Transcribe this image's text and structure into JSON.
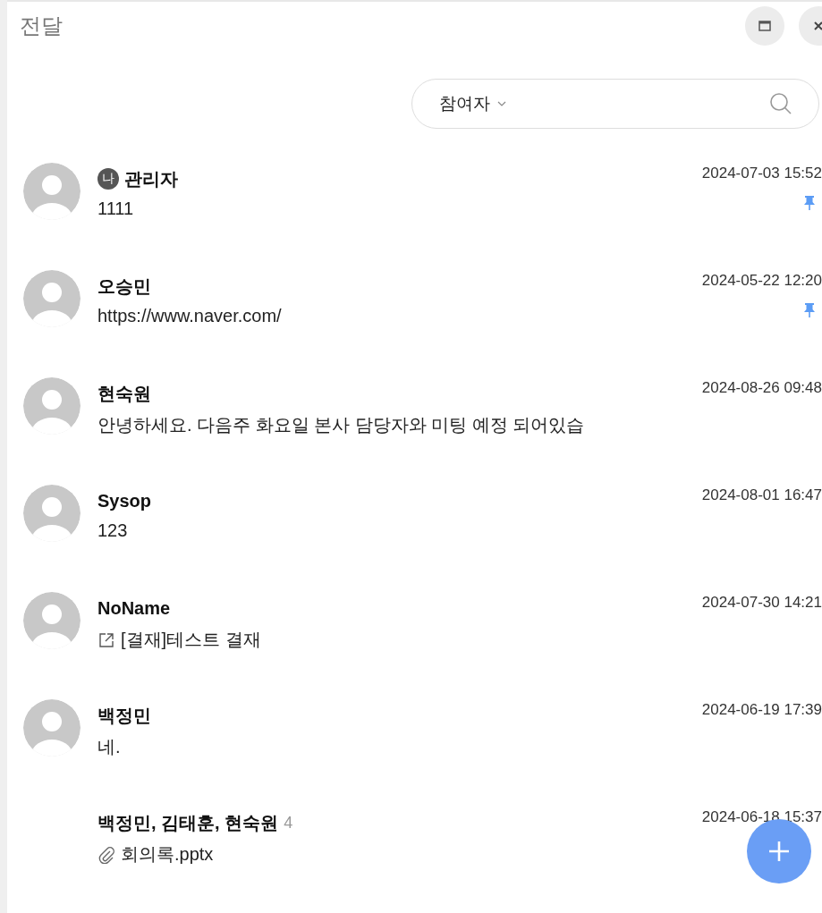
{
  "window": {
    "title": "전달"
  },
  "search": {
    "filter": "참여자"
  },
  "conversations": [
    {
      "kind": "text",
      "name": "관리자",
      "me_badge": "나",
      "message": "1111",
      "time": "2024-07-03 15:52",
      "pinned": true,
      "avatar": true
    },
    {
      "kind": "text",
      "name": "오승민",
      "message": "https://www.naver.com/",
      "time": "2024-05-22 12:20",
      "pinned": true,
      "avatar": true
    },
    {
      "kind": "text",
      "name": "현숙원",
      "message": "안녕하세요. 다음주 화요일 본사 담당자와 미팅 예정 되어있습",
      "time": "2024-08-26 09:48",
      "pinned": false,
      "avatar": true
    },
    {
      "kind": "text",
      "name": "Sysop",
      "message": "123",
      "time": "2024-08-01 16:47",
      "pinned": false,
      "avatar": true
    },
    {
      "kind": "link",
      "name": "NoName",
      "message": "[결재]테스트 결재",
      "time": "2024-07-30 14:21",
      "pinned": false,
      "avatar": true
    },
    {
      "kind": "text",
      "name": "백정민",
      "message": "네.",
      "time": "2024-06-19 17:39",
      "pinned": false,
      "avatar": true
    },
    {
      "kind": "attachment",
      "name": "백정민, 김태훈, 현숙원",
      "member_count": "4",
      "message": "회의록.pptx",
      "time": "2024-06-18 15:37",
      "pinned": false,
      "avatar": false
    }
  ]
}
